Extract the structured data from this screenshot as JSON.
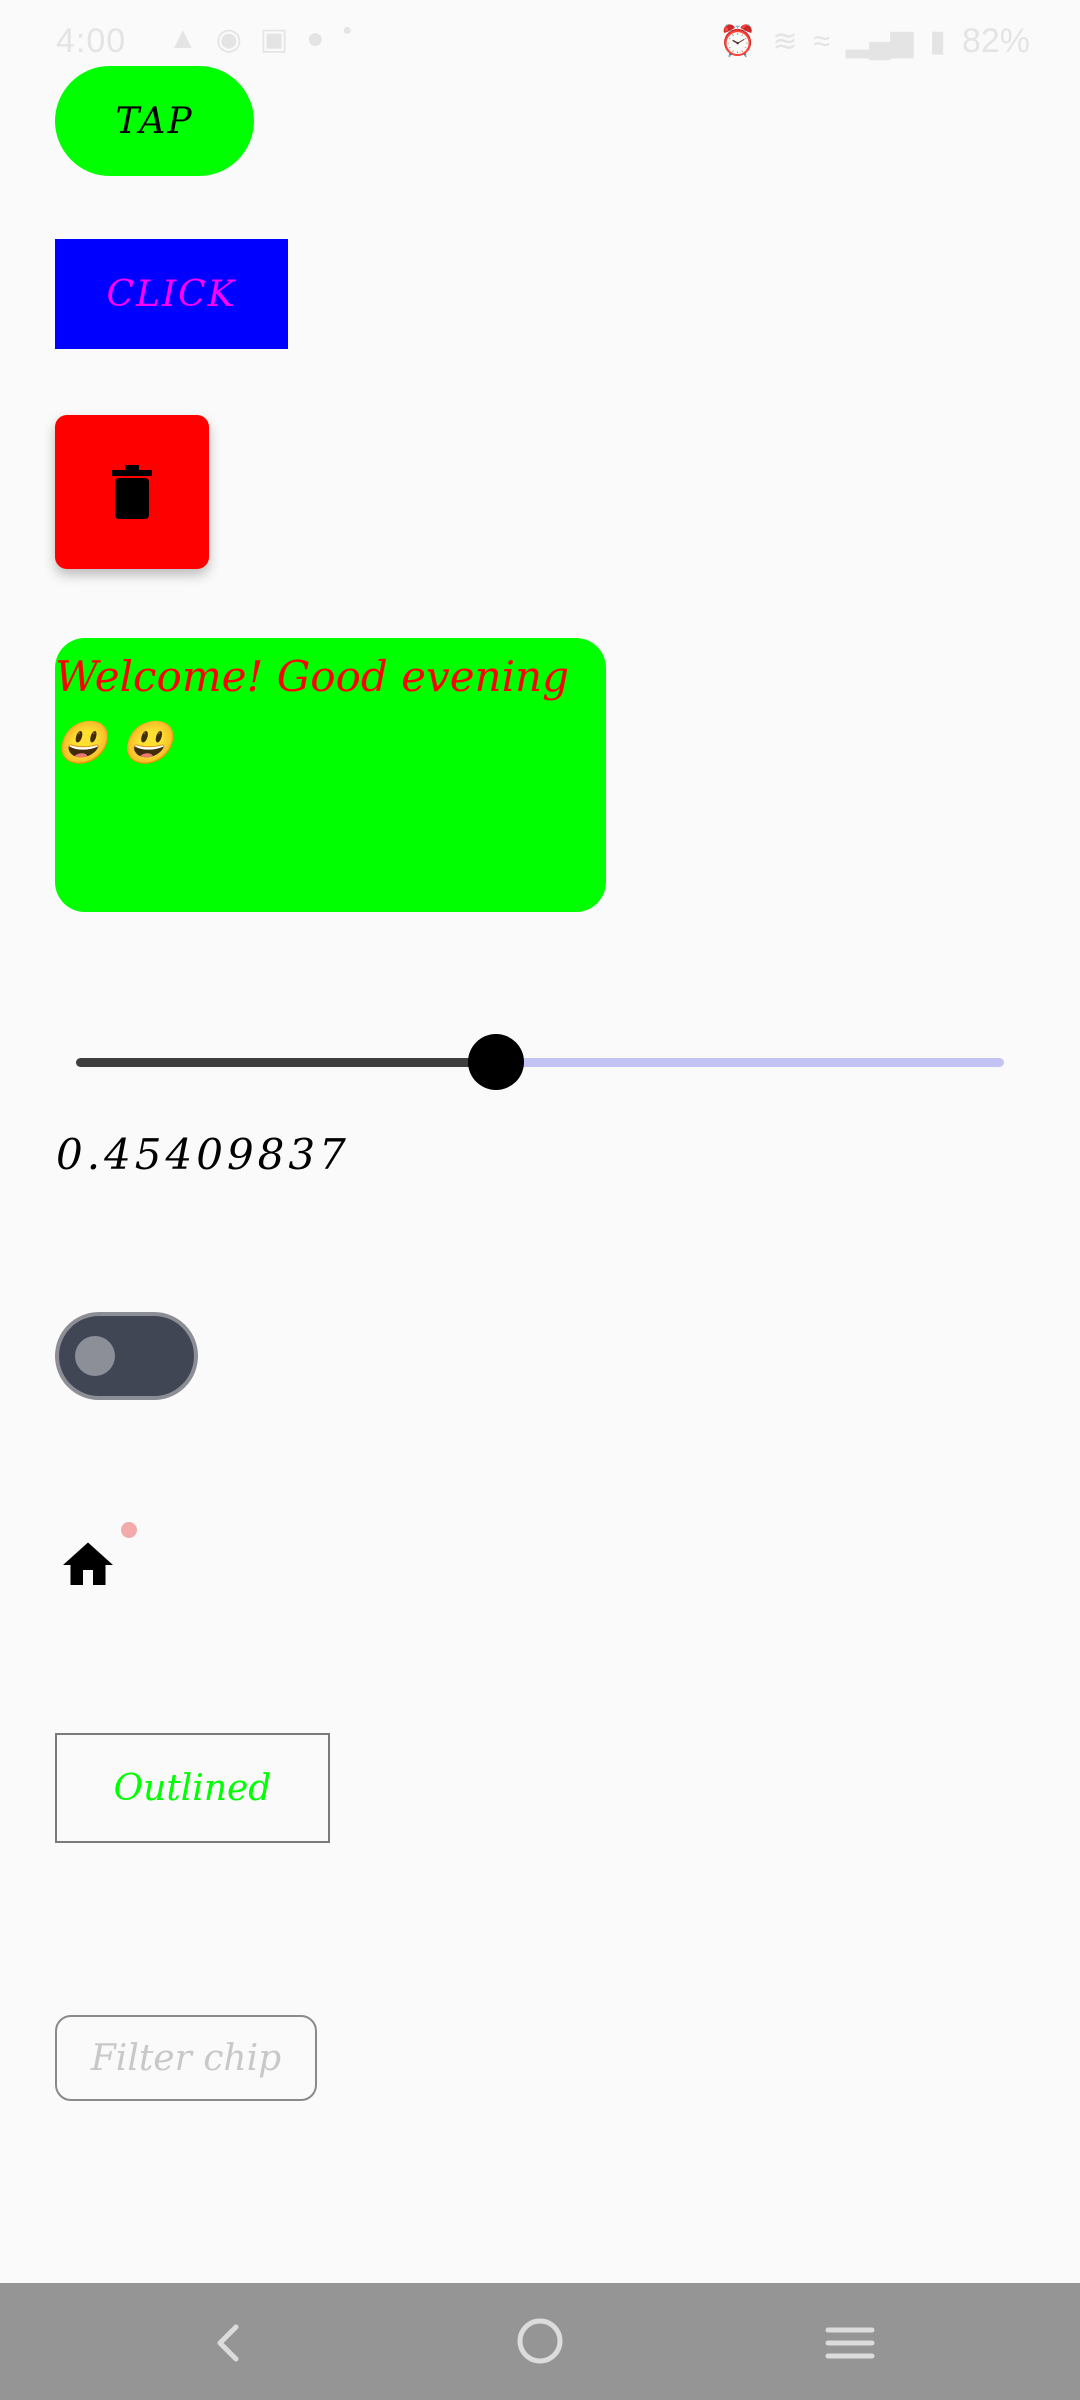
{
  "status_bar": {
    "time": "4:00",
    "battery": "82%",
    "left_icons": [
      "notification-icon",
      "location-icon",
      "instagram-icon",
      "status-icon",
      "dot-icon"
    ],
    "right_icons": [
      "alarm-icon",
      "vibrate-icon",
      "wifi-icon",
      "signal-icon",
      "battery-icon"
    ]
  },
  "buttons": {
    "tap_label": "TAP",
    "click_label": "CLICK",
    "outlined_label": "Outlined"
  },
  "delete_fab": {
    "icon": "trash-icon"
  },
  "welcome": {
    "text": "Welcome! Good evening 😃 😃"
  },
  "slider": {
    "value": 0.45409837,
    "display_value": "0.45409837"
  },
  "switch": {
    "checked": false
  },
  "home": {
    "icon": "home-icon",
    "has_badge": true
  },
  "filter_chip": {
    "label": "Filter chip",
    "enabled": false
  },
  "nav_bar": {
    "buttons": [
      "back-icon",
      "home-circle-icon",
      "menu-icon"
    ]
  },
  "colors": {
    "tap_bg": "#00ff00",
    "click_bg": "#0000ff",
    "click_text": "#ff00ff",
    "delete_bg": "#ff0000",
    "welcome_bg": "#00ff00",
    "welcome_text": "#ff0000",
    "outlined_text": "#00ff00",
    "slider_inactive": "#c3c3f5"
  }
}
